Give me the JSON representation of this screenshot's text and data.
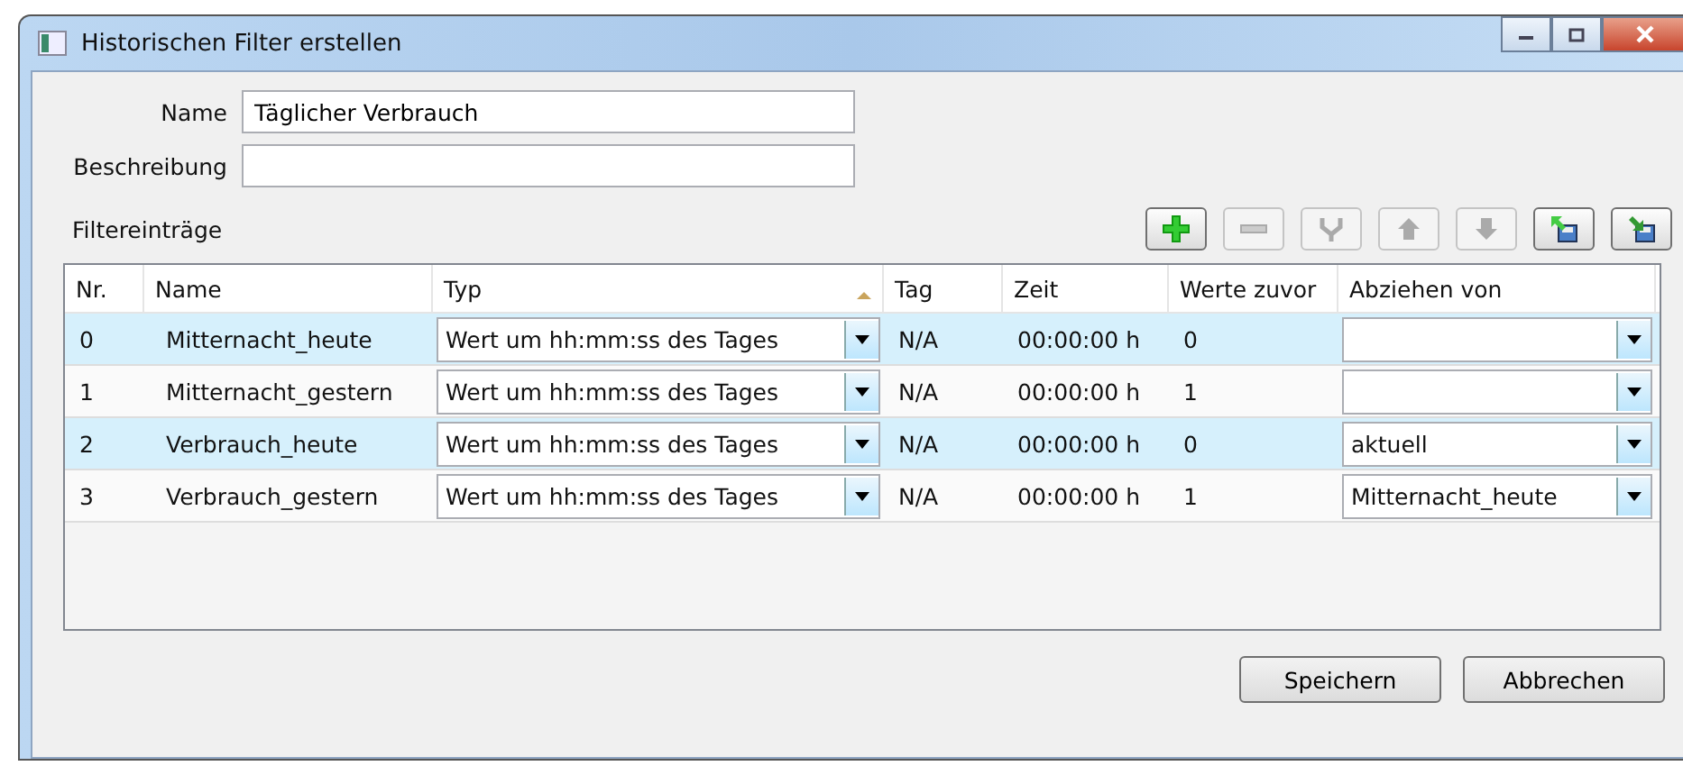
{
  "window": {
    "title": "Historischen Filter erstellen"
  },
  "fields": [
    {
      "label": "Name",
      "value": "Täglicher Verbrauch"
    },
    {
      "label": "Beschreibung"
    }
  ],
  "section_label": "Filtereinträge",
  "toolbar": [
    {
      "kind": "add",
      "disabled": false
    },
    {
      "kind": "remove",
      "disabled": true
    },
    {
      "kind": "merge",
      "disabled": true
    },
    {
      "kind": "up",
      "disabled": true
    },
    {
      "kind": "down",
      "disabled": true
    },
    {
      "kind": "export",
      "disabled": false
    },
    {
      "kind": "import",
      "disabled": false
    }
  ],
  "table": {
    "columns": [
      "Nr.",
      "Name",
      "Typ",
      "Tag",
      "Zeit",
      "Werte zuvor",
      "Abziehen von"
    ],
    "rows": [
      {
        "nr": "0",
        "name": "Mitternacht_heute",
        "typ": "Wert um hh:mm:ss des Tages",
        "tag": "N/A",
        "zeit": "00:00:00 h",
        "werte": "0"
      },
      {
        "nr": "1",
        "name": "Mitternacht_gestern",
        "typ": "Wert um hh:mm:ss des Tages",
        "tag": "N/A",
        "zeit": "00:00:00 h",
        "werte": "1"
      },
      {
        "nr": "2",
        "name": "Verbrauch_heute",
        "typ": "Wert um hh:mm:ss des Tages",
        "tag": "N/A",
        "zeit": "00:00:00 h",
        "werte": "0",
        "abziehen": "aktuell"
      },
      {
        "nr": "3",
        "name": "Verbrauch_gestern",
        "typ": "Wert um hh:mm:ss des Tages",
        "tag": "N/A",
        "zeit": "00:00:00 h",
        "werte": "1",
        "abziehen": "Mitternacht_heute"
      }
    ]
  },
  "buttons": [
    "Speichern",
    "Abbrechen"
  ]
}
